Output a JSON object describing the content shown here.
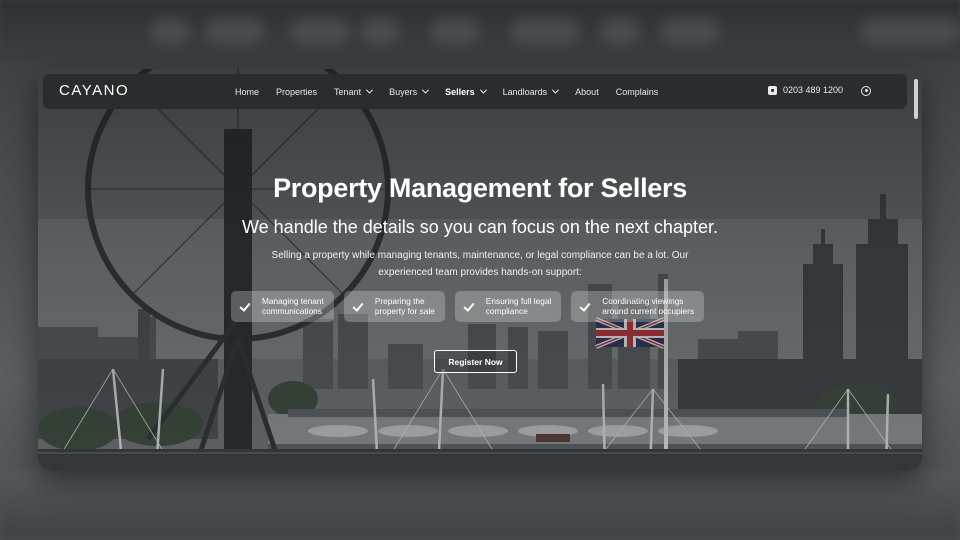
{
  "nav": {
    "logo": "CAYANO",
    "items": [
      {
        "label": "Home",
        "dropdown": false,
        "active": false
      },
      {
        "label": "Properties",
        "dropdown": false,
        "active": false
      },
      {
        "label": "Tenant",
        "dropdown": true,
        "active": false
      },
      {
        "label": "Buyers",
        "dropdown": true,
        "active": false
      },
      {
        "label": "Sellers",
        "dropdown": true,
        "active": true
      },
      {
        "label": "Landloards",
        "dropdown": true,
        "active": false
      },
      {
        "label": "About",
        "dropdown": false,
        "active": false
      },
      {
        "label": "Complains",
        "dropdown": false,
        "active": false
      }
    ],
    "phone": "0203 489 1200",
    "phone_icon": "phone-icon",
    "account_icon": "user-icon"
  },
  "hero": {
    "title": "Property Management for Sellers",
    "subtitle": "We handle the details so you can focus on the next chapter.",
    "body": "Selling a property while managing tenants, maintenance, or legal compliance can be a lot. Our experienced team provides hands-on support:",
    "features": [
      {
        "line1": "Managing tenant",
        "line2": "communications"
      },
      {
        "line1": "Preparing the",
        "line2": "property for sale"
      },
      {
        "line1": "Ensuring full legal",
        "line2": "compliance"
      },
      {
        "line1": "Coordinating viewings",
        "line2": "around current occupiers"
      }
    ],
    "cta": "Register Now"
  },
  "colors": {
    "nav_bg": "#2a2c2e",
    "text": "#ffffff",
    "feature_bg": "rgba(235,235,235,0.28)"
  }
}
